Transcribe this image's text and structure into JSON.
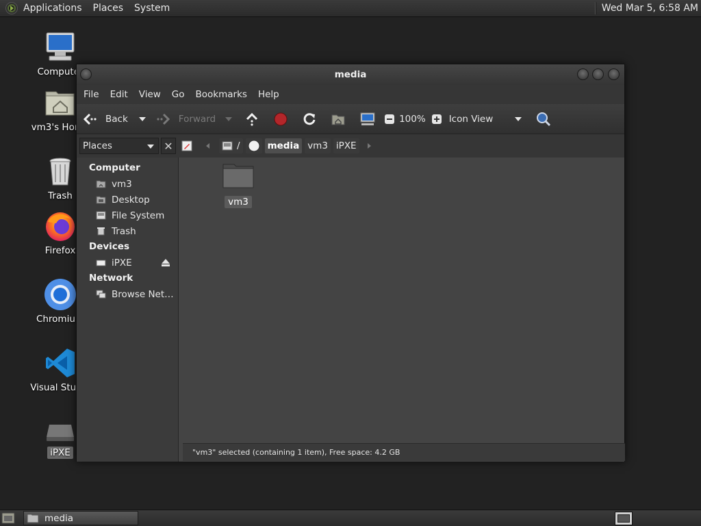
{
  "top_panel": {
    "menus": [
      "Applications",
      "Places",
      "System"
    ],
    "clock": "Wed Mar  5,  6:58 AM"
  },
  "desktop": {
    "icons": [
      {
        "label": "Computer",
        "icon": "computer-icon"
      },
      {
        "label": "vm3's Home",
        "icon": "home-folder-icon"
      },
      {
        "label": "Trash",
        "icon": "trash-icon"
      },
      {
        "label": "Firefox",
        "icon": "firefox-icon"
      },
      {
        "label": "Chromium",
        "icon": "chromium-icon"
      },
      {
        "label": "Visual Studio",
        "icon": "vscode-icon"
      },
      {
        "label": "iPXE",
        "icon": "drive-icon",
        "selected": true
      }
    ]
  },
  "window": {
    "title": "media",
    "menu": [
      "File",
      "Edit",
      "View",
      "Go",
      "Bookmarks",
      "Help"
    ],
    "toolbar": {
      "back": "Back",
      "forward": "Forward",
      "zoom": "100%",
      "view_mode": "Icon View"
    },
    "location": {
      "places_label": "Places",
      "root": "/",
      "crumbs": [
        "media",
        "vm3",
        "iPXE"
      ],
      "active_crumb": "media"
    },
    "sidebar": {
      "sections": [
        {
          "title": "Computer",
          "items": [
            {
              "label": "vm3",
              "icon": "home-icon"
            },
            {
              "label": "Desktop",
              "icon": "desktop-icon"
            },
            {
              "label": "File System",
              "icon": "filesystem-icon"
            },
            {
              "label": "Trash",
              "icon": "trash-icon"
            }
          ]
        },
        {
          "title": "Devices",
          "items": [
            {
              "label": "iPXE",
              "icon": "drive-icon",
              "eject": true
            }
          ]
        },
        {
          "title": "Network",
          "items": [
            {
              "label": "Browse Net…",
              "icon": "network-icon"
            }
          ]
        }
      ]
    },
    "content": {
      "items": [
        {
          "label": "vm3",
          "icon": "folder-icon",
          "selected": true
        }
      ]
    },
    "status": "\"vm3\" selected (containing 1 item), Free space: 4.2 GB"
  },
  "bottom_panel": {
    "task_label": "media"
  }
}
